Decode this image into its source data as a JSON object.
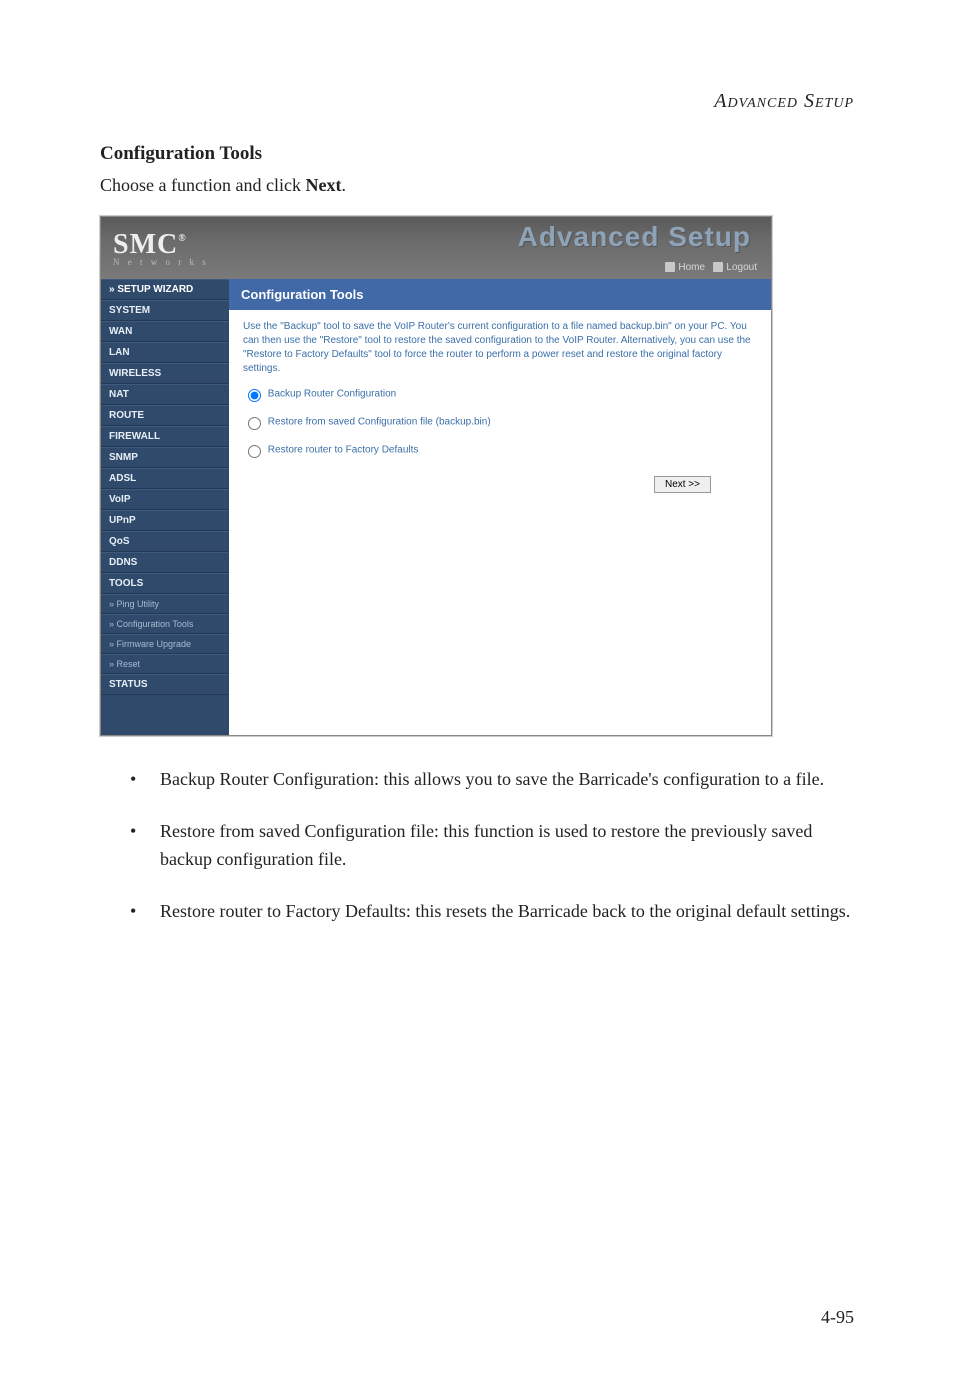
{
  "doc": {
    "header": "Advanced Setup",
    "h2": "Configuration Tools",
    "subtitle_prefix": "Choose a function and click ",
    "subtitle_bold": "Next",
    "subtitle_suffix": ".",
    "page_number": "4-95"
  },
  "screenshot": {
    "logo_main": "SMC",
    "logo_sup": "®",
    "logo_sub": "N e t w o r k s",
    "title_graphic": "Advanced Setup",
    "header_links": {
      "home": "Home",
      "logout": "Logout"
    },
    "sidebar": {
      "items": [
        {
          "label": "» SETUP WIZARD",
          "cls": "item bold"
        },
        {
          "label": "SYSTEM",
          "cls": "item section"
        },
        {
          "label": "WAN",
          "cls": "item section"
        },
        {
          "label": "LAN",
          "cls": "item section"
        },
        {
          "label": "WIRELESS",
          "cls": "item section"
        },
        {
          "label": "NAT",
          "cls": "item section"
        },
        {
          "label": "ROUTE",
          "cls": "item section"
        },
        {
          "label": "FIREWALL",
          "cls": "item section"
        },
        {
          "label": "SNMP",
          "cls": "item section"
        },
        {
          "label": "ADSL",
          "cls": "item section"
        },
        {
          "label": "VoIP",
          "cls": "item section"
        },
        {
          "label": "UPnP",
          "cls": "item section"
        },
        {
          "label": "QoS",
          "cls": "item section"
        },
        {
          "label": "DDNS",
          "cls": "item section"
        },
        {
          "label": "TOOLS",
          "cls": "item section"
        },
        {
          "label": "» Ping Utility",
          "cls": "item sub"
        },
        {
          "label": "» Configuration Tools",
          "cls": "item sub"
        },
        {
          "label": "» Firmware Upgrade",
          "cls": "item sub"
        },
        {
          "label": "» Reset",
          "cls": "item sub"
        },
        {
          "label": "STATUS",
          "cls": "item section"
        }
      ]
    },
    "panel": {
      "title": "Configuration Tools",
      "description": "Use the \"Backup\" tool to save the VoIP Router's current configuration to a file named backup.bin\" on your PC. You can then use the \"Restore\" tool to restore the saved configuration to the VoIP Router.  Alternatively, you can use the \"Restore to Factory Defaults\" tool to force the router to perform a power reset and restore the original factory settings.",
      "options": {
        "opt1": "Backup Router Configuration",
        "opt2": "Restore from saved Configuration file (backup.bin)",
        "opt3": "Restore router to Factory Defaults"
      },
      "next_label": "Next >>"
    }
  },
  "bullets": {
    "b1": "Backup Router Configuration: this allows you to save the Barricade's configuration to a file.",
    "b2": "Restore from saved Configuration file: this function is used to restore the previously saved backup configuration file.",
    "b3": "Restore router to Factory Defaults: this resets the Barricade back to the original default settings."
  }
}
